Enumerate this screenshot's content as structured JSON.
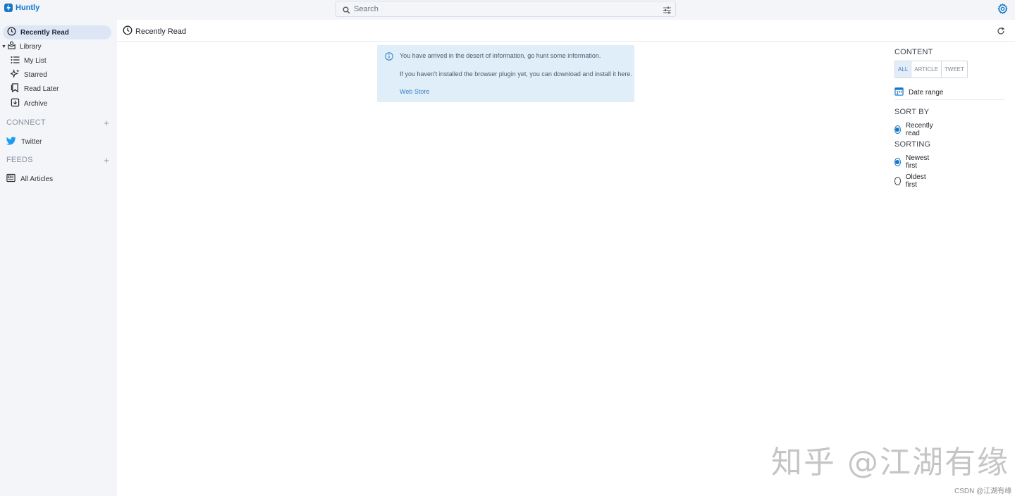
{
  "app": {
    "name": "Huntly",
    "brand_color": "#1677c9"
  },
  "search": {
    "placeholder": "Search"
  },
  "sidebar": {
    "active_item": {
      "label": "Recently Read"
    },
    "library": {
      "label": "Library",
      "items": [
        {
          "label": "My List",
          "icon": "list-icon"
        },
        {
          "label": "Starred",
          "icon": "sparkle-icon"
        },
        {
          "label": "Read Later",
          "icon": "bookmark-icon"
        },
        {
          "label": "Archive",
          "icon": "archive-icon"
        }
      ]
    },
    "connect": {
      "heading": "CONNECT",
      "items": [
        {
          "label": "Twitter",
          "icon": "twitter-icon"
        }
      ]
    },
    "feeds": {
      "heading": "FEEDS",
      "items": [
        {
          "label": "All Articles",
          "icon": "newspaper-icon"
        }
      ]
    }
  },
  "main": {
    "title": "Recently Read",
    "info": {
      "line1": "You have arrived in the desert of information, go hunt some information.",
      "line2": "If you haven't installed the browser plugin yet, you can download and install it here.",
      "link": "Web Store"
    }
  },
  "filters": {
    "content": {
      "heading": "CONTENT",
      "options": [
        "ALL",
        "ARTICLE",
        "TWEET"
      ],
      "selected": "ALL"
    },
    "date_range": {
      "label": "Date range"
    },
    "sort_by": {
      "heading": "SORT BY",
      "options": [
        {
          "label": "Recently read",
          "checked": true
        }
      ]
    },
    "sorting": {
      "heading": "SORTING",
      "options": [
        {
          "label": "Newest first",
          "checked": true
        },
        {
          "label": "Oldest first",
          "checked": false
        }
      ]
    }
  },
  "watermark": {
    "zhihu": "知乎 @江湖有缘",
    "csdn": "CSDN @江湖有缘"
  }
}
